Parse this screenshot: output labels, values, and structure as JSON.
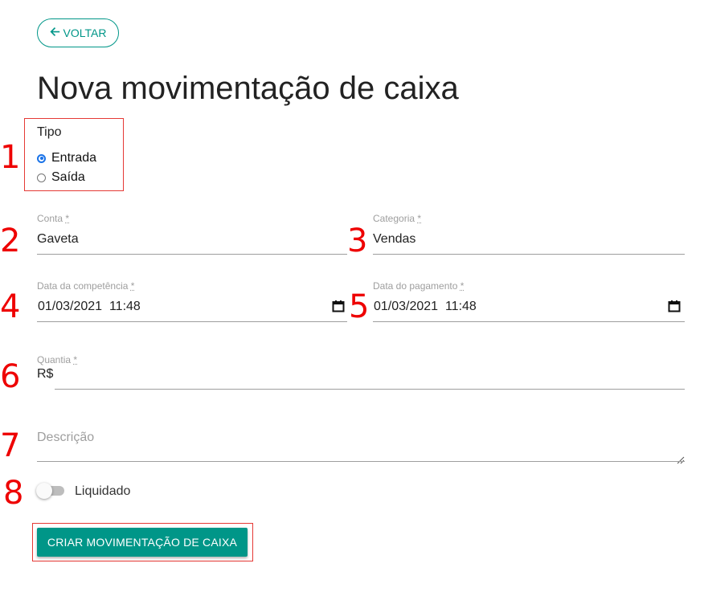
{
  "back_button": {
    "label": "VOLTAR",
    "icon": "arrow-left-icon",
    "color": "#009688"
  },
  "page_title": "Nova movimentação de caixa",
  "tipo": {
    "legend": "Tipo",
    "options": [
      {
        "label": "Entrada",
        "checked": true
      },
      {
        "label": "Saída",
        "checked": false
      }
    ]
  },
  "conta": {
    "label": "Conta",
    "required_mark": "*",
    "value": "Gaveta"
  },
  "categoria": {
    "label": "Categoria",
    "required_mark": "*",
    "value": "Vendas"
  },
  "data_competencia": {
    "label": "Data da competência",
    "required_mark": "*",
    "value": "01/03/2021  11:48",
    "icon": "calendar-icon"
  },
  "data_pagamento": {
    "label": "Data do pagamento",
    "required_mark": "*",
    "value": "01/03/2021  11:48",
    "icon": "calendar-icon"
  },
  "quantia": {
    "label": "Quantia",
    "required_mark": "*",
    "prefix": "R$",
    "value": ""
  },
  "descricao": {
    "placeholder": "Descrição"
  },
  "liquidado": {
    "label": "Liquidado",
    "checked": false
  },
  "submit_button": {
    "label": "CRIAR MOVIMENTAÇÃO DE CAIXA",
    "color": "#009688"
  },
  "annotations": {
    "color": "#ee0000",
    "markers": [
      "1",
      "2",
      "3",
      "4",
      "5",
      "6",
      "7",
      "8"
    ]
  }
}
